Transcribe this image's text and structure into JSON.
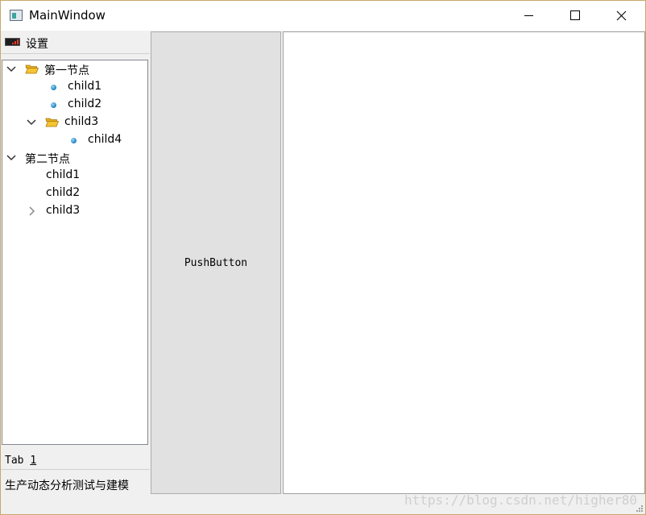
{
  "window": {
    "title": "MainWindow",
    "icon": "app-window-icon"
  },
  "titlebar_buttons": {
    "minimize_icon": "minimize-icon",
    "maximize_icon": "maximize-icon",
    "close_icon": "close-icon"
  },
  "left_panel": {
    "header_label": "设置",
    "header_icon": "signal-bars-icon",
    "tree": [
      {
        "label": "第一节点",
        "level": 0,
        "expanded": true,
        "icon": "folder-open-icon"
      },
      {
        "label": "child1",
        "level": 1,
        "icon": "bullet-icon"
      },
      {
        "label": "child2",
        "level": 1,
        "icon": "bullet-icon"
      },
      {
        "label": "child3",
        "level": 1,
        "expanded": true,
        "icon": "folder-open-icon"
      },
      {
        "label": "child4",
        "level": 2,
        "icon": "bullet-icon"
      },
      {
        "label": "第二节点",
        "level": 0,
        "expanded": true,
        "icon": ""
      },
      {
        "label": "child1",
        "level": 1,
        "icon": ""
      },
      {
        "label": "child2",
        "level": 1,
        "icon": ""
      },
      {
        "label": "child3",
        "level": 1,
        "expanded": false,
        "icon": ""
      }
    ],
    "tab_label_prefix": "Tab ",
    "tab_label_mnemonic": "1",
    "bottom_label": "生产动态分析测试与建模"
  },
  "center": {
    "push_button_label": "PushButton"
  },
  "watermark": "https://blog.csdn.net/higher80",
  "colors": {
    "window_border": "#c9a86a",
    "folder": "#f5c431",
    "bullet": "#1b7fc0"
  }
}
